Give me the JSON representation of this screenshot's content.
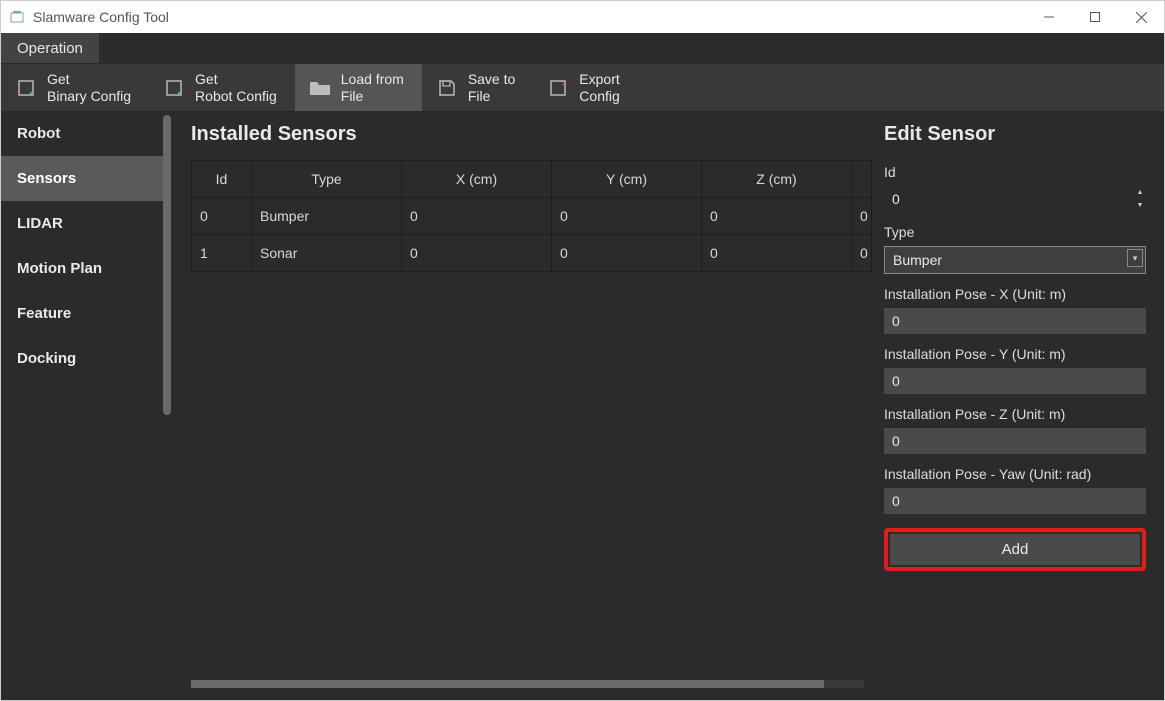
{
  "window": {
    "title": "Slamware Config Tool"
  },
  "menu": {
    "operation": "Operation"
  },
  "toolbar": {
    "get_binary": {
      "line1": "Get",
      "line2": "Binary Config"
    },
    "get_robot": {
      "line1": "Get",
      "line2": "Robot Config"
    },
    "load_file": {
      "line1": "Load from",
      "line2": "File"
    },
    "save_file": {
      "line1": "Save to",
      "line2": "File"
    },
    "export": {
      "line1": "Export",
      "line2": "Config"
    }
  },
  "sidebar": {
    "items": [
      {
        "label": "Robot"
      },
      {
        "label": "Sensors"
      },
      {
        "label": "LIDAR"
      },
      {
        "label": "Motion Plan"
      },
      {
        "label": "Feature"
      },
      {
        "label": "Docking"
      }
    ],
    "active_index": 1
  },
  "installed": {
    "title": "Installed Sensors",
    "columns": {
      "id": "Id",
      "type": "Type",
      "x": "X (cm)",
      "y": "Y (cm)",
      "z": "Z (cm)"
    },
    "rows": [
      {
        "id": "0",
        "type": "Bumper",
        "x": "0",
        "y": "0",
        "z": "0",
        "extra": "0"
      },
      {
        "id": "1",
        "type": "Sonar",
        "x": "0",
        "y": "0",
        "z": "0",
        "extra": "0"
      }
    ]
  },
  "edit": {
    "title": "Edit Sensor",
    "id_label": "Id",
    "id_value": "0",
    "type_label": "Type",
    "type_value": "Bumper",
    "x_label": "Installation Pose - X (Unit: m)",
    "x_value": "0",
    "y_label": "Installation Pose - Y (Unit: m)",
    "y_value": "0",
    "z_label": "Installation Pose - Z (Unit: m)",
    "z_value": "0",
    "yaw_label": "Installation Pose - Yaw (Unit: rad)",
    "yaw_value": "0",
    "add_label": "Add"
  }
}
